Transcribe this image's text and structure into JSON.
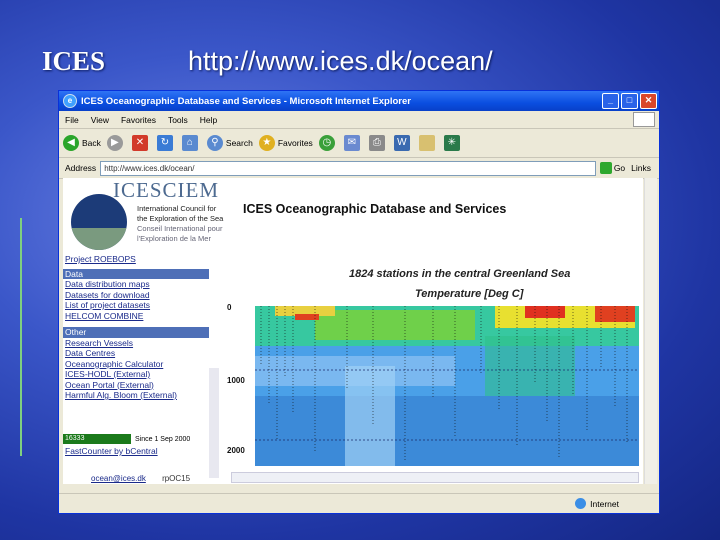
{
  "slide": {
    "title_left": "ICES",
    "title_url": "http://www.ices.dk/ocean/"
  },
  "browser": {
    "title": "ICES Oceanographic Database and Services - Microsoft Internet Explorer",
    "menu": [
      "File",
      "View",
      "Favorites",
      "Tools",
      "Help"
    ],
    "toolbar": {
      "back_label": "Back",
      "search_label": "Search",
      "favorites_label": "Favorites"
    },
    "address_label": "Address",
    "address_value": "http://www.ices.dk/ocean/",
    "go_label": "Go",
    "links_label": "Links",
    "status_zone": "Internet"
  },
  "page": {
    "brand": "ICESCIEM",
    "org_lines": [
      "International Council for",
      "the Exploration of the Sea",
      "Conseil International pour",
      "l'Exploration de la Mer"
    ],
    "title": "ICES Oceanographic Database and Services",
    "nav_top": "Project ROEBOPS",
    "nav_data_header": "Data",
    "nav_data_items": [
      "Data distribution maps",
      "Datasets for download",
      "List of project datasets",
      "HELCOM COMBINE"
    ],
    "nav_other_header": "Other",
    "nav_other_items": [
      "Research Vessels",
      "Data Centres",
      "Oceanographic Calculator",
      "ICES-HODL (External)",
      "Ocean Portal (External)",
      "Harmful Alg. Bloom (External)"
    ],
    "counter_value": "16333",
    "counter_since": "Since 1 Sep 2000",
    "fastcounter_link": "FastCounter by bCentral",
    "email": "ocean@ices.dk",
    "version": "rpOC15"
  },
  "chart_data": {
    "type": "heatmap",
    "title": "1824 stations in the central Greenland Sea",
    "subtitle": "Temperature [Deg C]",
    "y_ticks": [
      "0",
      "1000",
      "2000"
    ]
  }
}
